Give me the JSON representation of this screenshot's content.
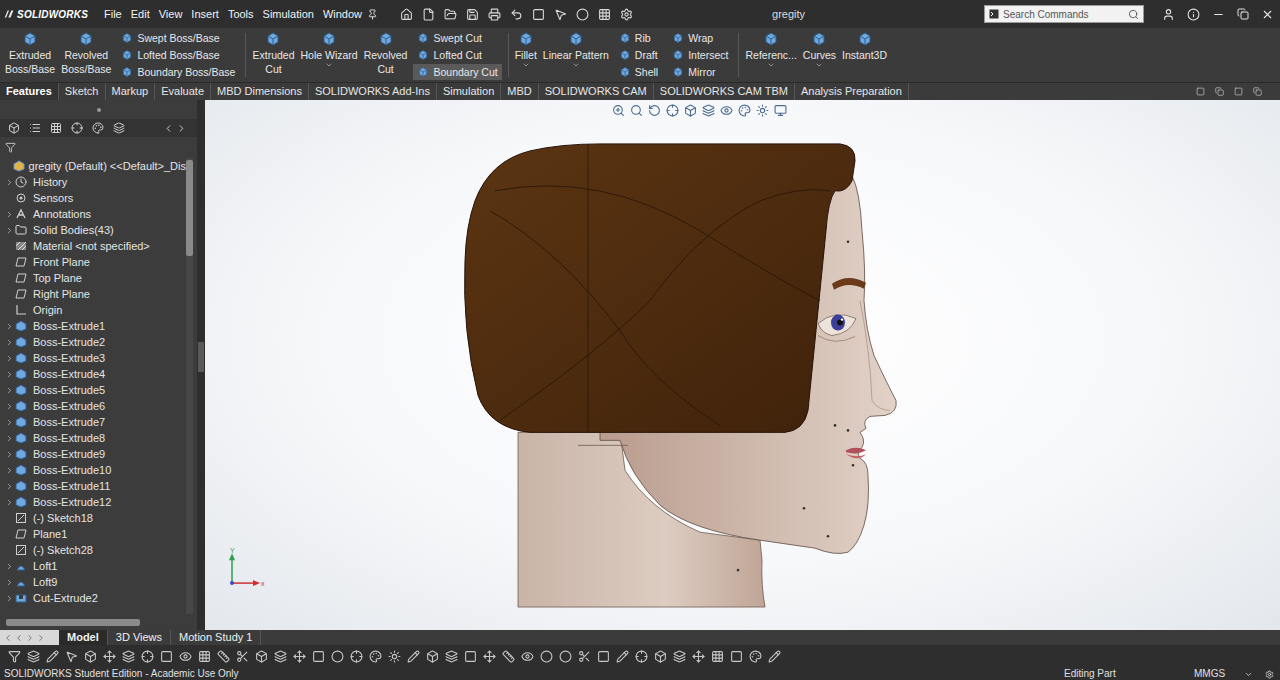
{
  "title_bar": {
    "logo": "SOLIDWORKS",
    "menus": [
      "File",
      "Edit",
      "View",
      "Insert",
      "Tools",
      "Simulation",
      "Window"
    ],
    "document": "gregity",
    "search": {
      "placeholder": "Search Commands"
    }
  },
  "ribbon": {
    "groups": [
      {
        "kind": "large",
        "lines": [
          "Extruded",
          "Boss/Base"
        ],
        "caret": false
      },
      {
        "kind": "large",
        "lines": [
          "Revolved",
          "Boss/Base"
        ],
        "caret": false
      },
      {
        "kind": "stack",
        "items": [
          {
            "label": "Swept Boss/Base",
            "highlighted": false
          },
          {
            "label": "Lofted Boss/Base",
            "highlighted": false
          },
          {
            "label": "Boundary Boss/Base",
            "highlighted": false
          }
        ]
      },
      {
        "kind": "large",
        "lines": [
          "Extruded",
          "Cut"
        ],
        "caret": false
      },
      {
        "kind": "large",
        "lines": [
          "Hole Wizard"
        ],
        "caret": true
      },
      {
        "kind": "large",
        "lines": [
          "Revolved",
          "Cut"
        ],
        "caret": false
      },
      {
        "kind": "stack",
        "items": [
          {
            "label": "Swept Cut",
            "highlighted": false
          },
          {
            "label": "Lofted Cut",
            "highlighted": false
          },
          {
            "label": "Boundary Cut",
            "highlighted": true
          }
        ]
      },
      {
        "kind": "large",
        "lines": [
          "Fillet"
        ],
        "caret": true
      },
      {
        "kind": "large",
        "lines": [
          "Linear Pattern"
        ],
        "caret": true
      },
      {
        "kind": "stack",
        "items": [
          {
            "label": "Rib",
            "highlighted": false
          },
          {
            "label": "Draft",
            "highlighted": false
          },
          {
            "label": "Shell",
            "highlighted": false
          }
        ]
      },
      {
        "kind": "stack",
        "items": [
          {
            "label": "Wrap",
            "highlighted": false
          },
          {
            "label": "Intersect",
            "highlighted": false
          },
          {
            "label": "Mirror",
            "highlighted": false
          }
        ]
      },
      {
        "kind": "large",
        "lines": [
          "Referenc..."
        ],
        "caret": true
      },
      {
        "kind": "large",
        "lines": [
          "Curves"
        ],
        "caret": true
      },
      {
        "kind": "large",
        "lines": [
          "Instant3D"
        ],
        "caret": false
      }
    ]
  },
  "tabs": [
    {
      "label": "Features",
      "selected": true
    },
    {
      "label": "Sketch",
      "selected": false
    },
    {
      "label": "Markup",
      "selected": false
    },
    {
      "label": "Evaluate",
      "selected": false
    },
    {
      "label": "MBD Dimensions",
      "selected": false
    },
    {
      "label": "SOLIDWORKS Add-Ins",
      "selected": false
    },
    {
      "label": "Simulation",
      "selected": false
    },
    {
      "label": "MBD",
      "selected": false
    },
    {
      "label": "SOLIDWORKS CAM",
      "selected": false
    },
    {
      "label": "SOLIDWORKS CAM TBM",
      "selected": false
    },
    {
      "label": "Analysis Preparation",
      "selected": false
    }
  ],
  "feature_tree": {
    "items": [
      {
        "label": "gregity (Default) <<Default>_Dis",
        "kind": "part",
        "expandable": false
      },
      {
        "label": "History",
        "kind": "history",
        "expandable": true
      },
      {
        "label": "Sensors",
        "kind": "sensors",
        "expandable": false
      },
      {
        "label": "Annotations",
        "kind": "annotations",
        "expandable": true
      },
      {
        "label": "Solid Bodies(43)",
        "kind": "bodies",
        "expandable": true
      },
      {
        "label": "Material <not specified>",
        "kind": "material",
        "expandable": false
      },
      {
        "label": "Front Plane",
        "kind": "plane",
        "expandable": false
      },
      {
        "label": "Top Plane",
        "kind": "plane",
        "expandable": false
      },
      {
        "label": "Right Plane",
        "kind": "plane",
        "expandable": false
      },
      {
        "label": "Origin",
        "kind": "origin",
        "expandable": false
      },
      {
        "label": "Boss-Extrude1",
        "kind": "extrude",
        "expandable": true
      },
      {
        "label": "Boss-Extrude2",
        "kind": "extrude",
        "expandable": true
      },
      {
        "label": "Boss-Extrude3",
        "kind": "extrude",
        "expandable": true
      },
      {
        "label": "Boss-Extrude4",
        "kind": "extrude",
        "expandable": true
      },
      {
        "label": "Boss-Extrude5",
        "kind": "extrude",
        "expandable": true
      },
      {
        "label": "Boss-Extrude6",
        "kind": "extrude",
        "expandable": true
      },
      {
        "label": "Boss-Extrude7",
        "kind": "extrude",
        "expandable": true
      },
      {
        "label": "Boss-Extrude8",
        "kind": "extrude",
        "expandable": true
      },
      {
        "label": "Boss-Extrude9",
        "kind": "extrude",
        "expandable": true
      },
      {
        "label": "Boss-Extrude10",
        "kind": "extrude",
        "expandable": true
      },
      {
        "label": "Boss-Extrude11",
        "kind": "extrude",
        "expandable": true
      },
      {
        "label": "Boss-Extrude12",
        "kind": "extrude",
        "expandable": true
      },
      {
        "label": "(-) Sketch18",
        "kind": "sketch",
        "expandable": false
      },
      {
        "label": "Plane1",
        "kind": "plane",
        "expandable": false
      },
      {
        "label": "(-) Sketch28",
        "kind": "sketch",
        "expandable": false
      },
      {
        "label": "Loft1",
        "kind": "loft",
        "expandable": true
      },
      {
        "label": "Loft9",
        "kind": "loft",
        "expandable": true
      },
      {
        "label": "Cut-Extrude2",
        "kind": "cut",
        "expandable": true
      }
    ]
  },
  "triad": {
    "x_label": "x",
    "y_label": "Y"
  },
  "bottom_tabs": [
    {
      "label": "Model",
      "selected": true
    },
    {
      "label": "3D Views",
      "selected": false
    },
    {
      "label": "Motion Study 1",
      "selected": false
    }
  ],
  "status_bar": {
    "edition": "SOLIDWORKS Student Edition - Academic Use Only",
    "mode": "Editing Part",
    "units": "MMGS"
  }
}
